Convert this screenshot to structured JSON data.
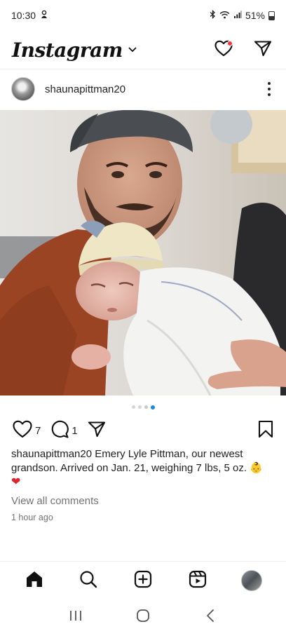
{
  "status_bar": {
    "time": "10:30",
    "battery": "51%"
  },
  "header": {
    "logo": "Instagram"
  },
  "post": {
    "username": "shaunapittman20",
    "image_count": 4,
    "active_image": 4,
    "likes": "7",
    "comments": "1",
    "caption_user": "shaunapittman20",
    "caption_text": " Emery Lyle Pittman, our newest grandson. Arrived on Jan.  21, weighing 7 lbs, 5 oz. 👶",
    "caption_emoji_2": "❤",
    "view_comments": "View all comments",
    "time_ago": "1 hour ago"
  },
  "colors": {
    "accent": "#1e88e5",
    "like_red": "#ff3040",
    "muted_text": "#737373"
  },
  "icons": {
    "header": [
      "chevron-down-icon",
      "heart-icon",
      "direct-message-icon"
    ],
    "actions": [
      "heart-icon",
      "comment-icon",
      "share-icon",
      "bookmark-icon"
    ],
    "tabs": [
      "home-icon",
      "search-icon",
      "create-icon",
      "reels-icon",
      "profile-icon"
    ],
    "system": [
      "recent-apps-icon",
      "home-circle-icon",
      "back-icon"
    ]
  }
}
